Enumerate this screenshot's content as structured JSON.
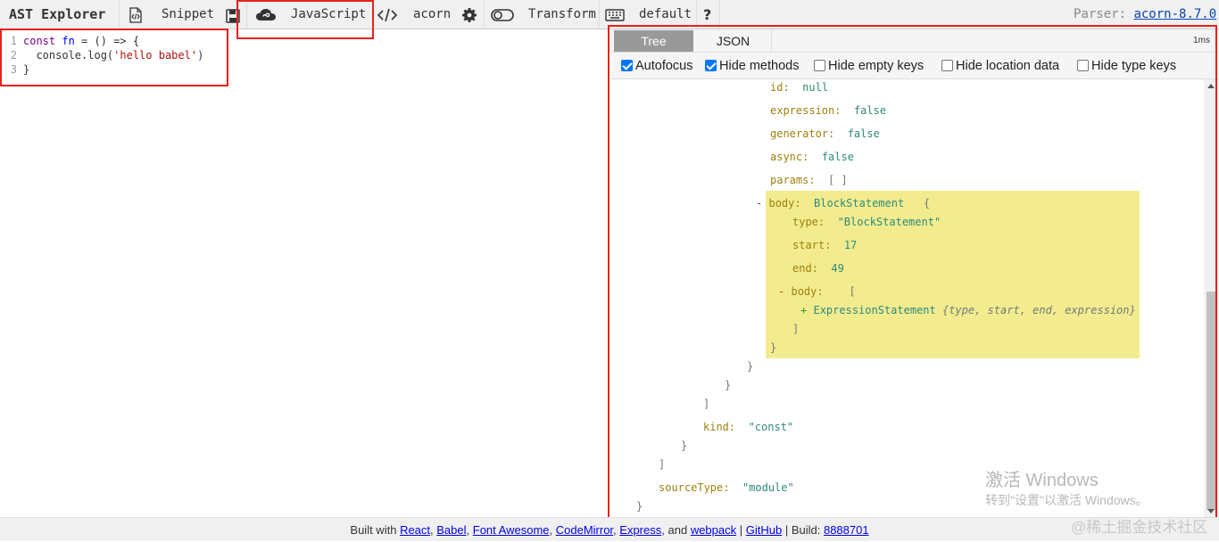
{
  "toolbar": {
    "title": "AST Explorer",
    "snippet": "Snippet",
    "language": "JavaScript",
    "parser_name": "acorn",
    "transform": "Transform",
    "keymap": "default",
    "help": "?",
    "parser_label": "Parser:",
    "parser_version": "acorn-8.7.0",
    "icons": [
      "file-code-icon",
      "save-icon",
      "cloud-icon",
      "code-icon",
      "gear-icon",
      "toggle-icon",
      "keyboard-icon",
      "question-icon"
    ]
  },
  "editor": {
    "lines": [
      {
        "n": "1",
        "a": "const",
        "b": " ",
        "c": "fn",
        "d": " = () => {",
        "e": "",
        "f": ""
      },
      {
        "n": "2",
        "a": "",
        "b": "  console.log(",
        "c": "",
        "d": "",
        "e": "'hello babel'",
        "f": ")"
      },
      {
        "n": "3",
        "a": "",
        "b": "}",
        "c": "",
        "d": "",
        "e": "",
        "f": ""
      }
    ]
  },
  "panel": {
    "tabs": [
      "Tree",
      "JSON"
    ],
    "time": "1ms",
    "options": [
      {
        "label": "Autofocus",
        "checked": true
      },
      {
        "label": "Hide methods",
        "checked": true
      },
      {
        "label": "Hide empty keys",
        "checked": false
      },
      {
        "label": "Hide location data",
        "checked": false
      },
      {
        "label": "Hide type keys",
        "checked": false
      }
    ]
  },
  "tree": {
    "id_key": "id:",
    "id_val": "null",
    "expr_key": "expression:",
    "expr_val": "false",
    "gen_key": "generator:",
    "gen_val": "false",
    "async_key": "async:",
    "async_val": "false",
    "params_key": "params:",
    "params_val": "[ ]",
    "body_toggle": "-",
    "body_key": "body:",
    "body_type": "BlockStatement",
    "body_open": "{",
    "type_key": "type:",
    "type_val": "\"BlockStatement\"",
    "start_key": "start:",
    "start_val": "17",
    "end_key": "end:",
    "end_val": "49",
    "body2_toggle": "-",
    "body2_key": "body:",
    "body2_open": "[",
    "expr_toggle": "+",
    "expr_type": "ExpressionStatement",
    "expr_summary": "{type, start, end, expression}",
    "close_bracket1": "]",
    "close_brace1": "}",
    "close_brace2": "}",
    "close_brace3": "}",
    "close_bracket2": "]",
    "kind_key": "kind:",
    "kind_val": "\"const\"",
    "close_brace4": "}",
    "close_bracket3": "]",
    "src_key": "sourceType:",
    "src_val": "\"module\"",
    "close_brace5": "}"
  },
  "watermark": {
    "line1": "激活 Windows",
    "line2": "转到\"设置\"以激活 Windows。",
    "site": "@稀土掘金技术社区"
  },
  "footer": {
    "built_with": "Built with",
    "links": [
      "React",
      "Babel",
      "Font Awesome",
      "CodeMirror",
      "Express",
      "webpack",
      "GitHub"
    ],
    "and": "and",
    "build_label": "Build:",
    "build_id": "8888701"
  },
  "colors": {
    "highlight": "#f2ec8f",
    "annotation": "#e8201a",
    "link": "#0645ad"
  }
}
